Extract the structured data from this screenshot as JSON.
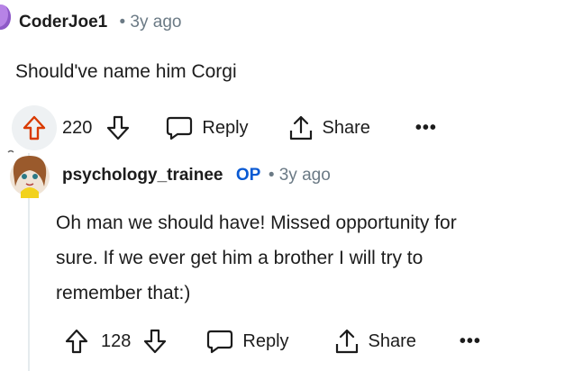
{
  "comment1": {
    "username": "CoderJoe1",
    "time": "• 3y ago",
    "body": "Should've name him Corgi",
    "votes": "220",
    "reply_label": "Reply",
    "share_label": "Share",
    "more_label": "•••"
  },
  "comment2": {
    "username": "psychology_trainee",
    "op_badge": "OP",
    "time": "• 3y ago",
    "body_lines": [
      "Oh man we should have! Missed opportunity for",
      "sure. If we ever get him a brother I will try to",
      "remember that:)"
    ],
    "votes": "128",
    "reply_label": "Reply",
    "share_label": "Share",
    "more_label": "•••"
  },
  "colors": {
    "upvote_active": "#d93a00",
    "op": "#0a5ad3",
    "muted": "#6b7a85"
  }
}
